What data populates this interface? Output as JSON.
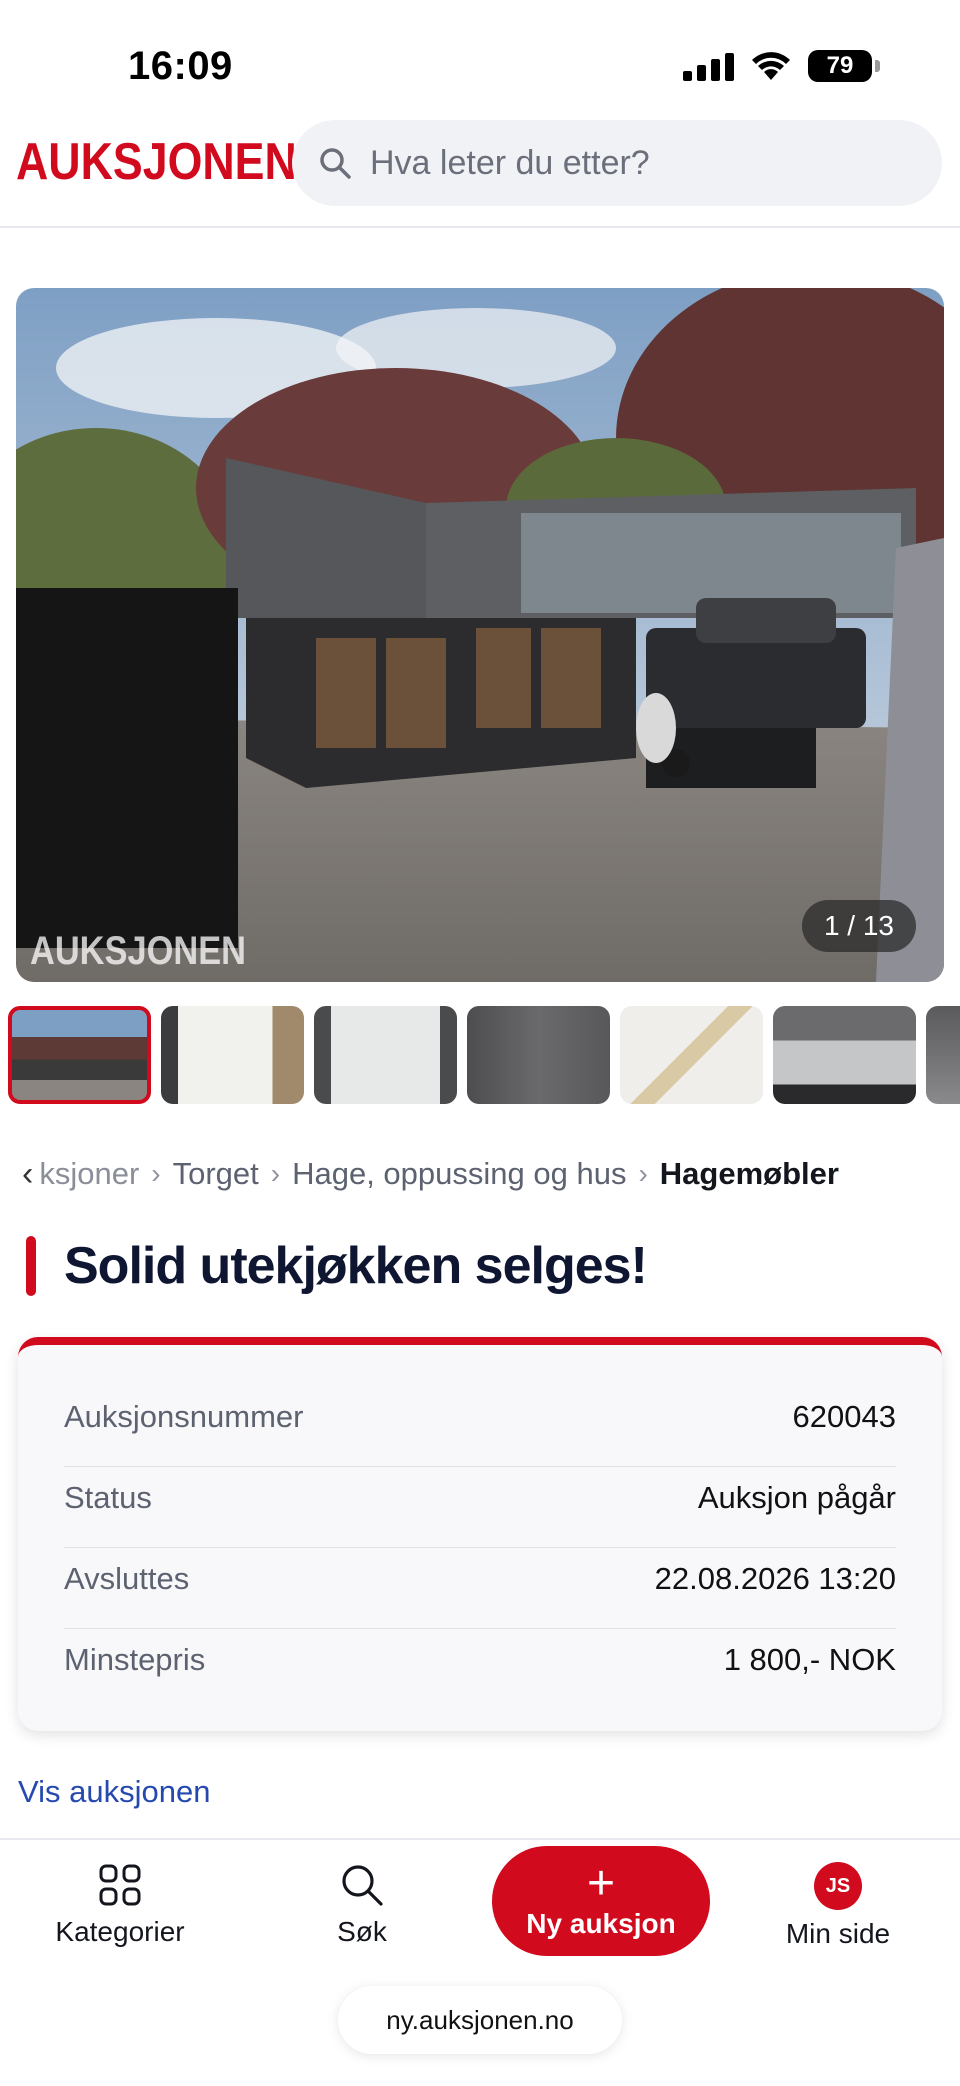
{
  "status_bar": {
    "time": "16:09",
    "battery": "79"
  },
  "header": {
    "logo": "AUKSJONEN",
    "search_placeholder": "Hva leter du etter?"
  },
  "gallery": {
    "counter": "1 / 13",
    "watermark": "AUKSJONEN",
    "thumb_count": 7
  },
  "breadcrumb": {
    "items": [
      "ksjoner",
      "Torget",
      "Hage, oppussing og hus"
    ],
    "current": "Hagemøbler"
  },
  "listing": {
    "title": "Solid utekjøkken selges!"
  },
  "details": [
    {
      "label": "Auksjonsnummer",
      "value": "620043"
    },
    {
      "label": "Status",
      "value": "Auksjon pågår"
    },
    {
      "label": "Avsluttes",
      "value": "22.08.2026 13:20"
    },
    {
      "label": "Minstepris",
      "value": "1 800,- NOK"
    }
  ],
  "view_link": "Vis auksjonen",
  "bottom_nav": {
    "categories": "Kategorier",
    "search": "Søk",
    "new_auction": "Ny auksjon",
    "my_page": "Min side",
    "avatar_initials": "JS"
  },
  "browser": {
    "url": "ny.auksjonen.no"
  },
  "colors": {
    "brand_red": "#d20a1e",
    "link_blue": "#2649b0",
    "title_navy": "#0f1631"
  }
}
